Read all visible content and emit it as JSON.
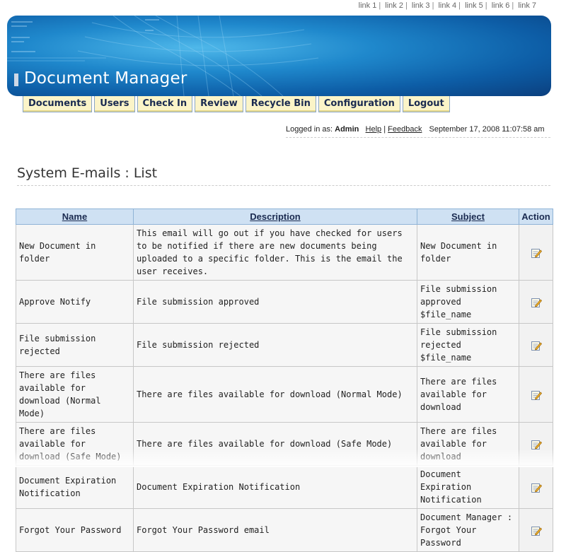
{
  "top_links": [
    "link 1",
    "link 2",
    "link 3",
    "link 4",
    "link 5",
    "link 6",
    "link 7"
  ],
  "top_links_sep": "|",
  "banner": {
    "title": "Document Manager"
  },
  "nav": {
    "tabs": [
      "Documents",
      "Users",
      "Check In",
      "Review",
      "Recycle Bin",
      "Configuration",
      "Logout"
    ]
  },
  "login": {
    "prefix": "Logged in as:",
    "user": "Admin",
    "help": "Help",
    "sep": "|",
    "feedback": "Feedback",
    "datetime": "September 17, 2008 11:07:58 am"
  },
  "page": {
    "heading": "System E-mails : List"
  },
  "table": {
    "headers": {
      "name": "Name",
      "description": "Description",
      "subject": "Subject",
      "action": "Action"
    },
    "rows": [
      {
        "name": "New Document in folder",
        "description": "This email will go out if you have checked for users to be notified if there are new documents being uploaded to a specific folder. This is the email the user receives.",
        "subject": "New Document in folder"
      },
      {
        "name": "Approve Notify",
        "description": "File submission approved",
        "subject": "File submission approved $file_name"
      },
      {
        "name": "File submission rejected",
        "description": "File submission rejected",
        "subject": "File submission rejected $file_name"
      },
      {
        "name": "There are files available for download (Normal Mode)",
        "description": "There are files available for download (Normal Mode)",
        "subject": "There are files available for download"
      },
      {
        "name": "There are files available for download (Safe Mode)",
        "description": "There are files available for download (Safe Mode)",
        "subject": "There are files available for download"
      },
      {
        "name": "Document Expiration Notification",
        "description": "Document Expiration Notification",
        "subject": "Document Expiration Notification"
      },
      {
        "name": "Forgot Your Password",
        "description": "Forgot Your Password email",
        "subject": "Document Manager : Forgot Your Password"
      }
    ]
  },
  "icons": {
    "edit": "edit-icon"
  },
  "colors": {
    "banner": "#1f88cc",
    "tab_bg": "#fbf4c8",
    "header_bg": "#cfe1f3"
  }
}
